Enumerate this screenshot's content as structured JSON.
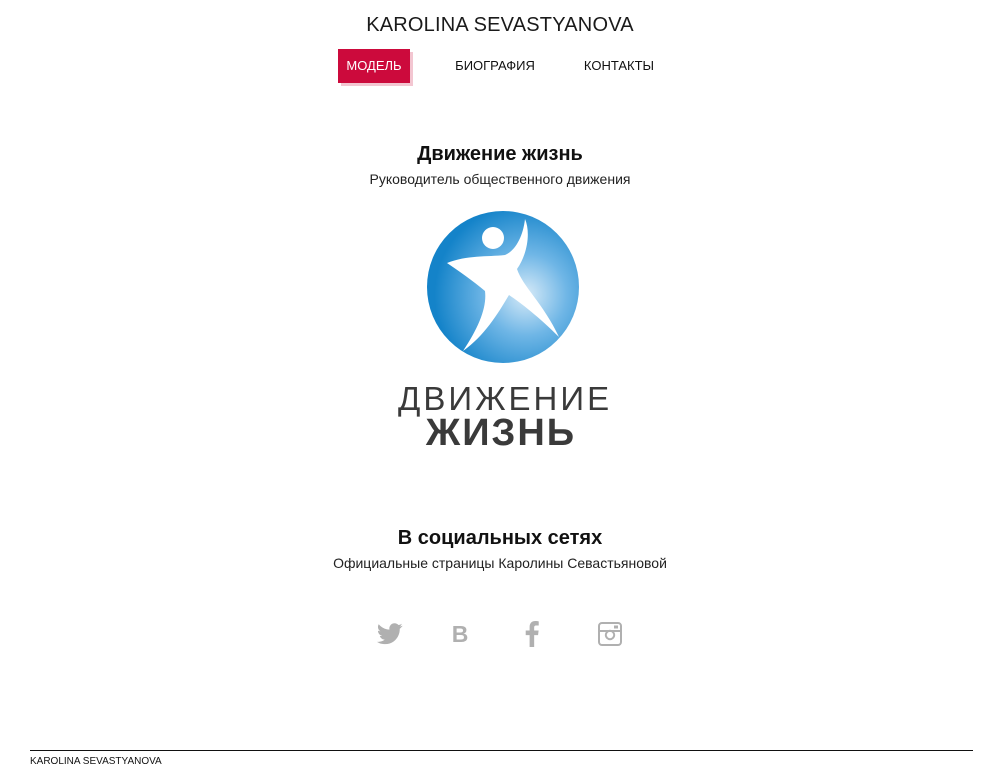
{
  "header": {
    "site_title": "KAROLINA SEVASTYANOVA"
  },
  "nav": {
    "items": [
      {
        "label": "МОДЕЛЬ",
        "active": true
      },
      {
        "label": "БИОГРАФИЯ",
        "active": false
      },
      {
        "label": "КОНТАКТЫ",
        "active": false
      }
    ]
  },
  "movement": {
    "title": "Движение жизнь",
    "subtitle": "Руководитель общественного движения",
    "logo": {
      "word1": "ДВИЖЕНИЕ",
      "word2": "ЖИЗНЬ",
      "icon": "running-figure-circle-icon"
    }
  },
  "social": {
    "title": "В социальных сетях",
    "subtitle": "Официальные страницы Каролины Севастьяновой",
    "links": [
      {
        "icon": "twitter-icon"
      },
      {
        "icon": "vk-icon",
        "glyph": "B"
      },
      {
        "icon": "facebook-icon"
      },
      {
        "icon": "instagram-icon"
      }
    ]
  },
  "footer": {
    "text": "KAROLINA SEVASTYANOVA"
  },
  "colors": {
    "accent": "#cc0a3c",
    "icon_gray": "#b0b0b0",
    "logo_blue": "#1a8fd0",
    "logo_text": "#3a3a3a"
  }
}
